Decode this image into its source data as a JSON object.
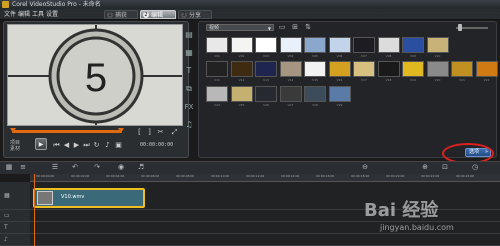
{
  "app": {
    "title": "Corel VideoStudio Pro - 未命名"
  },
  "menubar": {
    "items": [
      "文件",
      "编辑",
      "工具",
      "设置"
    ]
  },
  "steps": [
    {
      "num": "1",
      "label": "捕获"
    },
    {
      "num": "2",
      "label": "编辑"
    },
    {
      "num": "3",
      "label": "分享"
    }
  ],
  "player": {
    "countdown_number": "5",
    "mode_project": "项目",
    "mode_clip": "素材",
    "timecode": "00:00:00:00"
  },
  "library": {
    "category": "视频",
    "thumbnails": [
      {
        "label": "V01",
        "color": "#e8e8e8"
      },
      {
        "label": "V02",
        "color": "#f4f4f2"
      },
      {
        "label": "V03",
        "color": "#ffffff"
      },
      {
        "label": "V04",
        "color": "#eaf0fa"
      },
      {
        "label": "V05",
        "color": "#8aa8cc"
      },
      {
        "label": "V06",
        "color": "#c2d4ea"
      },
      {
        "label": "V07",
        "color": "#1c1c22"
      },
      {
        "label": "V08",
        "color": "#dcdcdc"
      },
      {
        "label": "V09",
        "color": "#2a4fa0"
      },
      {
        "label": "V10",
        "color": "#c8b278"
      },
      {
        "label": "V11",
        "color": "#222222"
      },
      {
        "label": "V12",
        "color": "#3f2a12"
      },
      {
        "label": "V13",
        "color": "#1e2650"
      },
      {
        "label": "V14",
        "color": "#a69580"
      },
      {
        "label": "V15",
        "color": "#f2f2f2"
      },
      {
        "label": "V16",
        "color": "#d4a020"
      },
      {
        "label": "V17",
        "color": "#d8c080"
      },
      {
        "label": "V18",
        "color": "#1a1a1a"
      },
      {
        "label": "V19",
        "color": "#e0b820"
      },
      {
        "label": "V20",
        "color": "#8a8a8a"
      },
      {
        "label": "V21",
        "color": "#c09020"
      },
      {
        "label": "V22",
        "color": "#d07a14"
      },
      {
        "label": "V23",
        "color": "#e0e0e0"
      },
      {
        "label": "V24",
        "color": "#b8b8b8"
      },
      {
        "label": "V25",
        "color": "#c4b070"
      },
      {
        "label": "V26",
        "color": "#262a30"
      },
      {
        "label": "V27",
        "color": "#3a3a3a"
      },
      {
        "label": "V28",
        "color": "#3d4c5a"
      },
      {
        "label": "V29",
        "color": "#5a7aa8"
      }
    ],
    "options_label": "选项",
    "options_chevron": "»"
  },
  "timeline": {
    "ticks": [
      "00:00:00:00",
      "00:00:02:00",
      "00:00:04:00",
      "00:00:06:00",
      "00:00:08:00",
      "00:00:10:00",
      "00:00:12:00",
      "00:00:14:00",
      "00:00:16:00",
      "00:00:18:00",
      "00:00:20:00",
      "00:00:22:00",
      "00:00:24:00"
    ],
    "clip_name": "V10.wmv"
  },
  "colors": {
    "accent_orange": "#e06a10",
    "clip_border": "#f0c020",
    "options_blue": "#2f5c9a",
    "highlight_red": "#e02020"
  },
  "watermark": {
    "text": "Bai 经验",
    "url": "jingyan.baidu.com"
  }
}
